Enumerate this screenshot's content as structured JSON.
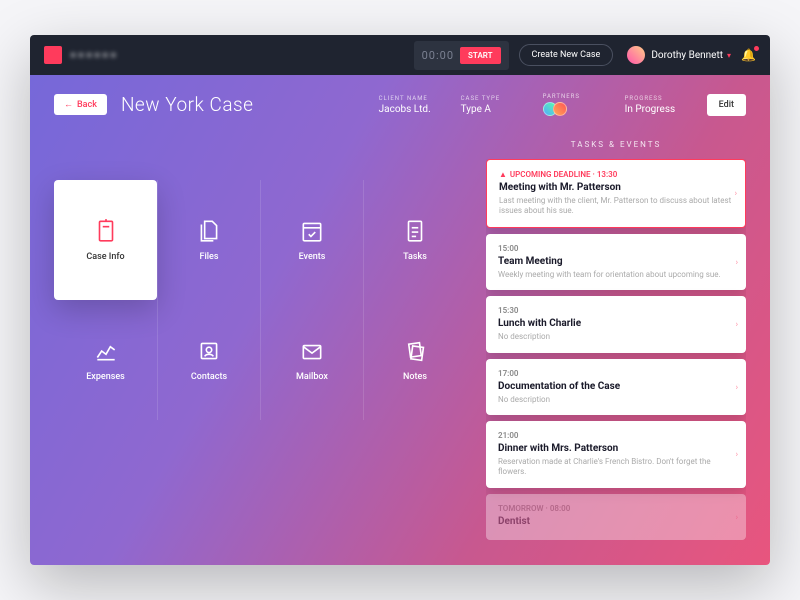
{
  "topbar": {
    "timer": "00:00",
    "start": "START",
    "create": "Create New Case",
    "user": "Dorothy Bennett"
  },
  "header": {
    "back": "Back",
    "title": "New York Case",
    "client_label": "CLIENT NAME",
    "client": "Jacobs Ltd.",
    "type_label": "CASE TYPE",
    "type": "Type A",
    "partners_label": "PARTNERS",
    "progress_label": "PROGRESS",
    "progress": "In Progress",
    "edit": "Edit"
  },
  "grid": {
    "case_info": "Case Info",
    "files": "Files",
    "events": "Events",
    "tasks": "Tasks",
    "expenses": "Expenses",
    "contacts": "Contacts",
    "mailbox": "Mailbox",
    "notes": "Notes"
  },
  "side": {
    "title": "Tasks & Events",
    "items": [
      {
        "time": "UPCOMING DEADLINE · 13:30",
        "title": "Meeting with Mr. Patterson",
        "desc": "Last meeting with the client, Mr. Patterson to discuss about latest issues about his sue.",
        "deadline": true
      },
      {
        "time": "15:00",
        "title": "Team Meeting",
        "desc": "Weekly meeting with team for orientation about upcoming sue."
      },
      {
        "time": "15:30",
        "title": "Lunch with Charlie",
        "desc": "No description"
      },
      {
        "time": "17:00",
        "title": "Documentation of the Case",
        "desc": "No description"
      },
      {
        "time": "21:00",
        "title": "Dinner with Mrs. Patterson",
        "desc": "Reservation made at Charlie's French Bistro. Don't forget the flowers."
      },
      {
        "time": "TOMORROW · 08:00",
        "title": "Dentist",
        "desc": "",
        "ghost": true
      }
    ]
  }
}
